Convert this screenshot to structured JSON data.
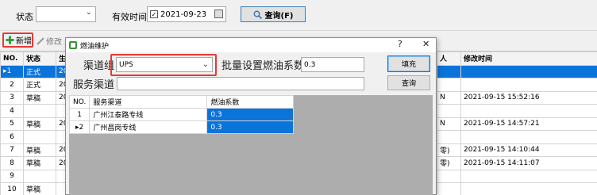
{
  "filter": {
    "status_label": "状态",
    "status_value": "",
    "valid_time_label": "有效时间",
    "date_value": "2021-09-23",
    "query_button": "查询(F)"
  },
  "toolbar": {
    "add_label": "新增",
    "edit_label": "修改"
  },
  "grid": {
    "columns": [
      "NO.",
      "状态",
      "生",
      "人",
      "修改时间"
    ],
    "rows": [
      {
        "no": "1",
        "status": "正式",
        "c3": "20",
        "c4": "",
        "time": ""
      },
      {
        "no": "2",
        "status": "正式",
        "c3": "20",
        "c4": "",
        "time": ""
      },
      {
        "no": "3",
        "status": "草稿",
        "c3": "20",
        "c4": "N",
        "time": "2021-09-15 15:52:16"
      },
      {
        "no": "4",
        "status": "",
        "c3": "",
        "c4": "",
        "time": ""
      },
      {
        "no": "5",
        "status": "草稿",
        "c3": "20",
        "c4": "N",
        "time": "2021-09-15 14:57:21"
      },
      {
        "no": "6",
        "status": "",
        "c3": "",
        "c4": "",
        "time": ""
      },
      {
        "no": "7",
        "status": "草稿",
        "c3": "20",
        "c4": "零)",
        "time": "2021-09-15 14:10:44"
      },
      {
        "no": "8",
        "status": "草稿",
        "c3": "20",
        "c4": "零)",
        "time": "2021-09-15 14:11:07"
      },
      {
        "no": "9",
        "status": "",
        "c3": "",
        "c4": "",
        "time": ""
      },
      {
        "no": "10",
        "status": "草稿",
        "c3": "",
        "c4": "",
        "time": ""
      }
    ]
  },
  "dialog": {
    "title": "燃油维护",
    "help": "?",
    "close": "✕",
    "channel_group_label": "渠道组",
    "channel_group_value": "UPS",
    "batch_label": "批量设置燃油系数",
    "batch_value": "0.3",
    "fill_button": "填充",
    "service_channel_label": "服务渠道",
    "service_channel_value": "",
    "query_button": "查询",
    "table": {
      "columns": [
        "NO.",
        "服务渠道",
        "燃油系数"
      ],
      "rows": [
        {
          "no": "1",
          "channel": "广州江泰路专线",
          "factor": "0.3"
        },
        {
          "no": "2",
          "channel": "广州昌岗专线",
          "factor": "0.3"
        }
      ]
    }
  },
  "colors": {
    "selection_blue": "#0a74da",
    "highlight_red": "#e53935",
    "add_green": "#2e9e3e"
  },
  "icons": {
    "query": "magnifier-icon",
    "add": "plus-icon",
    "edit": "pencil-icon",
    "calendar": "calendar-icon",
    "dialog": "app-icon"
  }
}
